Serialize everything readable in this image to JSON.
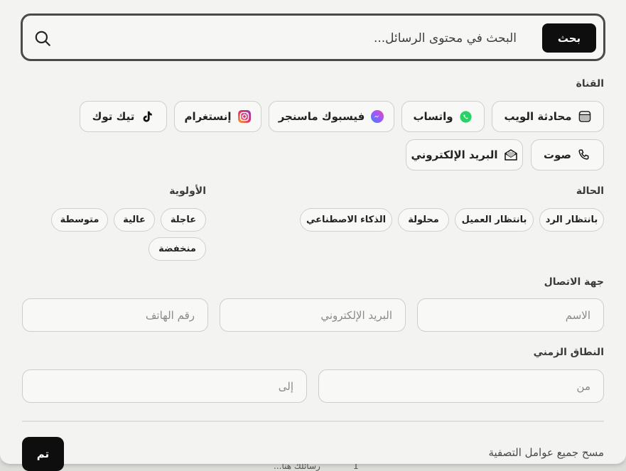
{
  "search": {
    "button_label": "بحث",
    "placeholder": "البحث في محتوى الرسائل..."
  },
  "channel": {
    "label": "القناة",
    "items": [
      {
        "label": "محادثة الويب",
        "icon": "web-chat-icon"
      },
      {
        "label": "واتساب",
        "icon": "whatsapp-icon",
        "color": "#25D366"
      },
      {
        "label": "فيسبوك ماسنجر",
        "icon": "messenger-icon",
        "color": "#7a5cf5"
      },
      {
        "label": "إنستغرام",
        "icon": "instagram-icon",
        "color": "#e1306c"
      },
      {
        "label": "تيك توك",
        "icon": "tiktok-icon"
      },
      {
        "label": "صوت",
        "icon": "phone-icon"
      },
      {
        "label": "البريد الإلكتروني",
        "icon": "envelope-icon"
      }
    ]
  },
  "status": {
    "label": "الحالة",
    "items": [
      "بانتظار الرد",
      "بانتظار العميل",
      "محلولة",
      "الذكاء الاصطناعي"
    ]
  },
  "priority": {
    "label": "الأولوية",
    "items": [
      "عاجلة",
      "عالية",
      "متوسطة",
      "منخفضة"
    ]
  },
  "contact": {
    "label": "جهة الاتصال",
    "name_placeholder": "الاسم",
    "email_placeholder": "البريد الإلكتروني",
    "phone_placeholder": "رقم الهاتف"
  },
  "time_range": {
    "label": "النطاق الزمني",
    "from_placeholder": "من",
    "to_placeholder": "إلى"
  },
  "footer": {
    "clear_label": "مسح جميع عوامل التصفية",
    "done_label": "تم"
  },
  "background": {
    "snippet": "رسائلك هنا...",
    "number": "1"
  }
}
